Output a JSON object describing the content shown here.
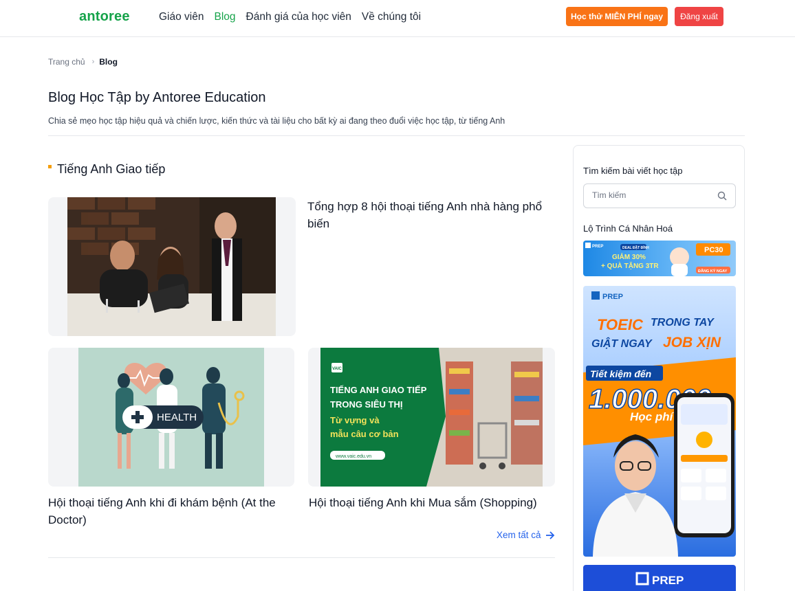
{
  "header": {
    "logo": "antoree",
    "nav": [
      {
        "label": "Giáo viên"
      },
      {
        "label": "Blog"
      },
      {
        "label": "Đánh giá của học viên"
      },
      {
        "label": "Về chúng tôi"
      }
    ],
    "trial_button": "Học thử MIỄN PHÍ ngay",
    "logout_button": "Đăng xuất"
  },
  "breadcrumb": {
    "home": "Trang chủ",
    "current": "Blog"
  },
  "page": {
    "title": "Blog Học Tập by Antoree Education",
    "description": "Chia sẻ mẹo học tập hiệu quả và chiến lược, kiến thức và tài liệu cho bất kỳ ai đang theo đuổi việc học tập, từ tiếng Anh"
  },
  "section": {
    "title": "Tiếng Anh Giao tiếp",
    "posts": [
      {
        "title": "Tổng hợp 8 hội thoại tiếng Anh nhà hàng phổ biến"
      },
      {
        "title": "Hội thoại tiếng Anh khi đi khám bệnh (At the Doctor)"
      },
      {
        "title": "Hội thoại tiếng Anh khi Mua sắm (Shopping)"
      }
    ],
    "view_all": "Xem tất cả"
  },
  "images": {
    "health_text": "HEALTH",
    "supermarket": {
      "brand": "VAIC",
      "line1": "TIẾNG ANH GIAO TIẾP",
      "line2": "TRONG SIÊU THỊ",
      "line3": "Từ vựng và",
      "line4": "mẫu câu cơ bản",
      "url": "www.vaic.edu.vn"
    }
  },
  "sidebar": {
    "search_label": "Tìm kiếm bài viết học tập",
    "search_placeholder": "Tìm kiếm",
    "roadmap_label": "Lộ Trình Cá Nhân Hoá",
    "banner1": {
      "brand": "PREP",
      "deal": "DEAL ĐẶT ĐỈNH",
      "discount": "GIẢM 30%",
      "gift": "+ QUÀ TẶNG 3TR",
      "code": "PC30",
      "cta": "ĐĂNG KÝ NGAY"
    },
    "banner2": {
      "brand": "PREP",
      "line1a": "TOEIC",
      "line1b": "TRONG TAY",
      "line2a": "GIẬT NGAY",
      "line2b": "JOB XỊN",
      "save_label": "Tiết kiệm đến",
      "amount": "1.000.000",
      "fee_label": "Học phí"
    },
    "banner3": {
      "brand": "PREP"
    }
  },
  "colors": {
    "brand_green": "#16a34a",
    "trial_orange": "#f97316",
    "logout_red": "#ef4444",
    "link_blue": "#2563eb",
    "section_dot": "#f59e0b"
  }
}
